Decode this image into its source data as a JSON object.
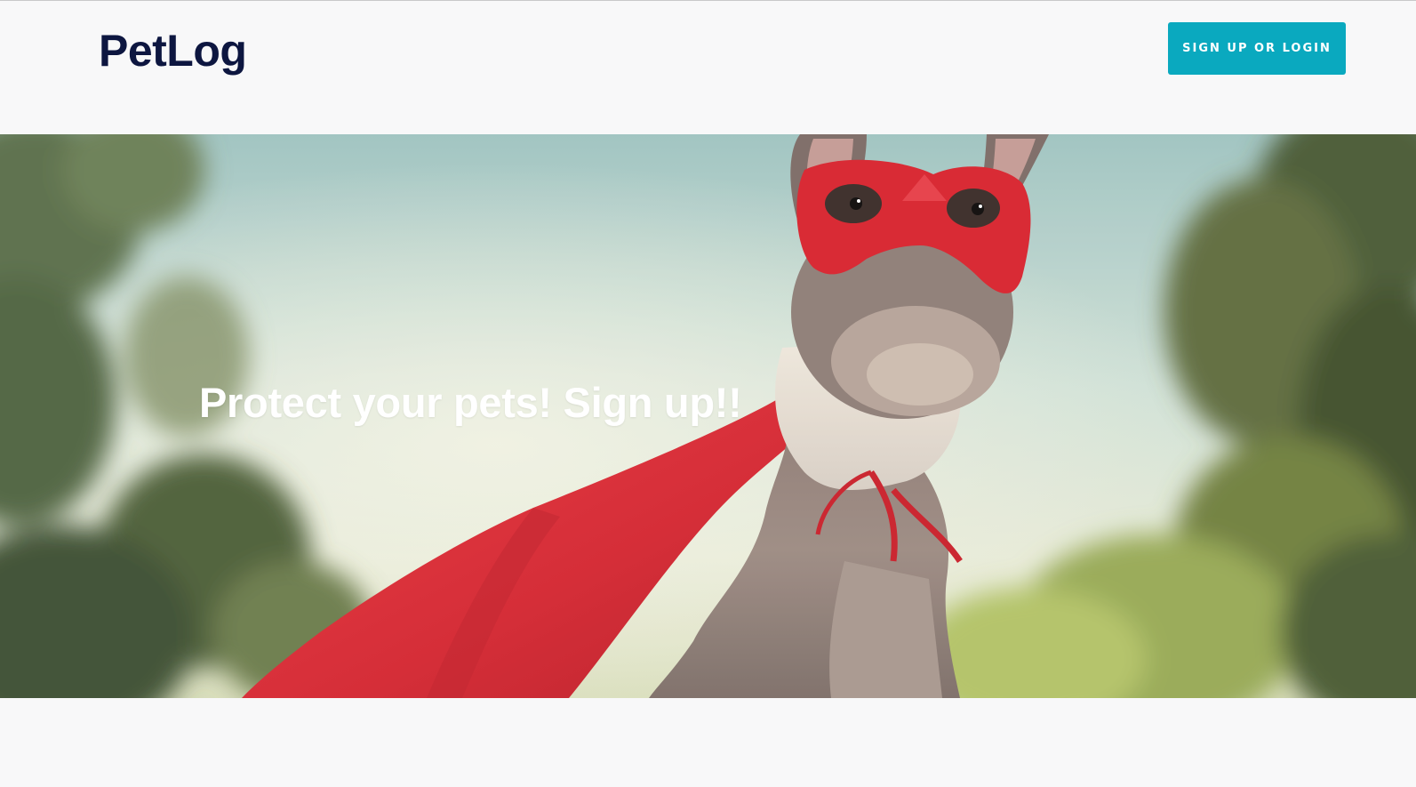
{
  "header": {
    "logo_text": "PetLog",
    "cta_label": "SIGN UP OR LOGIN"
  },
  "hero": {
    "heading": "Protect your pets! Sign up!!",
    "image_subject": "french-bulldog-superhero-photo"
  },
  "colors": {
    "logo": "#0d1640",
    "cta_background": "#0aa9bf",
    "page_background": "#f8f8f9",
    "hero_text": "#ffffff",
    "cape_red": "#d92b35"
  }
}
